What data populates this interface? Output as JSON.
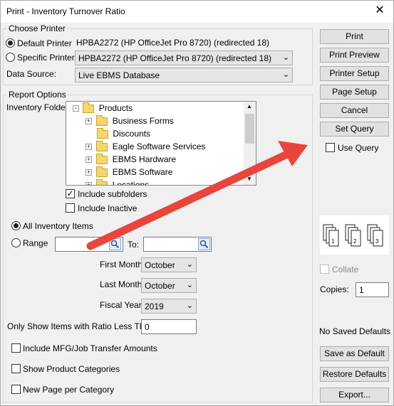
{
  "window": {
    "title": "Print - Inventory Turnover Ratio",
    "close_glyph": "✕"
  },
  "choose_printer": {
    "legend": "Choose Printer",
    "default_printer_label": "Default Printer",
    "default_printer_value": "HPBA2272 (HP OfficeJet Pro 8720) (redirected 18)",
    "specific_printer_label": "Specific Printer",
    "specific_printer_value": "HPBA2272 (HP OfficeJet Pro 8720) (redirected 18)",
    "data_source_label": "Data Source:",
    "data_source_value": "Live EBMS Database"
  },
  "report_options": {
    "legend": "Report Options",
    "inventory_folder_label": "Inventory Folder:",
    "tree": {
      "root": "Products",
      "items": [
        "Business Forms",
        "Discounts",
        "Eagle Software Services",
        "EBMS Hardware",
        "EBMS Software",
        "Locations"
      ]
    },
    "include_subfolders_label": "Include subfolders",
    "include_inactive_label": "Include Inactive",
    "all_items_label": "All Inventory Items",
    "range_label": "Range",
    "to_label": "To:",
    "first_month_label": "First Month:",
    "first_month_value": "October",
    "last_month_label": "Last Month:",
    "last_month_value": "October",
    "fiscal_year_label": "Fiscal Year:",
    "fiscal_year_value": "2019",
    "ratio_label": "Only Show Items with Ratio Less Than:",
    "ratio_value": "0",
    "include_mfg_label": "Include MFG/Job Transfer Amounts",
    "show_categories_label": "Show Product Categories",
    "new_page_label": "New Page per Category"
  },
  "buttons": {
    "print": "Print",
    "print_preview": "Print Preview",
    "printer_setup": "Printer Setup",
    "page_setup": "Page Setup",
    "cancel": "Cancel",
    "set_query": "Set Query",
    "use_query": "Use Query",
    "save_defaults": "Save as Default",
    "restore_defaults": "Restore Defaults",
    "export": "Export..."
  },
  "copies": {
    "collate_label": "Collate",
    "copies_label": "Copies:",
    "copies_value": "1",
    "page_numbers": [
      "1",
      "2",
      "3"
    ]
  },
  "defaults_status": "No Saved Defaults",
  "annotation": {
    "arrow_color": "#e8453c"
  }
}
